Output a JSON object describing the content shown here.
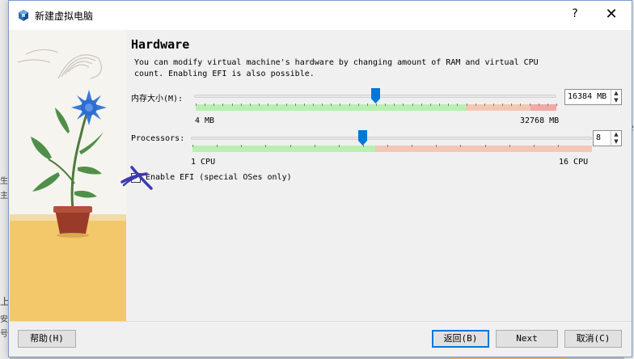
{
  "window": {
    "title": "新建虚拟电脑",
    "help_button": "?",
    "close_button": "✕"
  },
  "background": {
    "right_fragments": [
      "e",
      "x",
      "I",
      "I"
    ],
    "left_fragments": [
      "生",
      "主移",
      "上",
      "安",
      "号"
    ]
  },
  "page": {
    "heading": "Hardware",
    "description": "You can modify virtual machine's hardware by changing amount of RAM and virtual CPU count. Enabling EFI is also possible."
  },
  "memory": {
    "label": "内存大小(M):",
    "min_label": "4 MB",
    "max_label": "32768 MB",
    "value": "16384 MB",
    "value_mb": 16384,
    "min_mb": 4,
    "max_mb": 32768
  },
  "processors": {
    "label": "Processors:",
    "min_label": "1 CPU",
    "max_label": "16 CPU",
    "value": "8",
    "value_count": 8,
    "min_count": 1,
    "max_count": 16
  },
  "efi": {
    "label": "Enable EFI (special OSes only)",
    "checked": false
  },
  "footer": {
    "help": "帮助(H)",
    "back": "返回(B)",
    "next": "Next",
    "cancel": "取消(C)"
  },
  "colors": {
    "slider_green": "#b9f0b1",
    "slider_orange": "#f4c7b5",
    "slider_red": "#f2a9a9",
    "thumb_blue": "#0078d7",
    "accent": "#0078d7",
    "pen_mark": "#3a3ab0"
  }
}
